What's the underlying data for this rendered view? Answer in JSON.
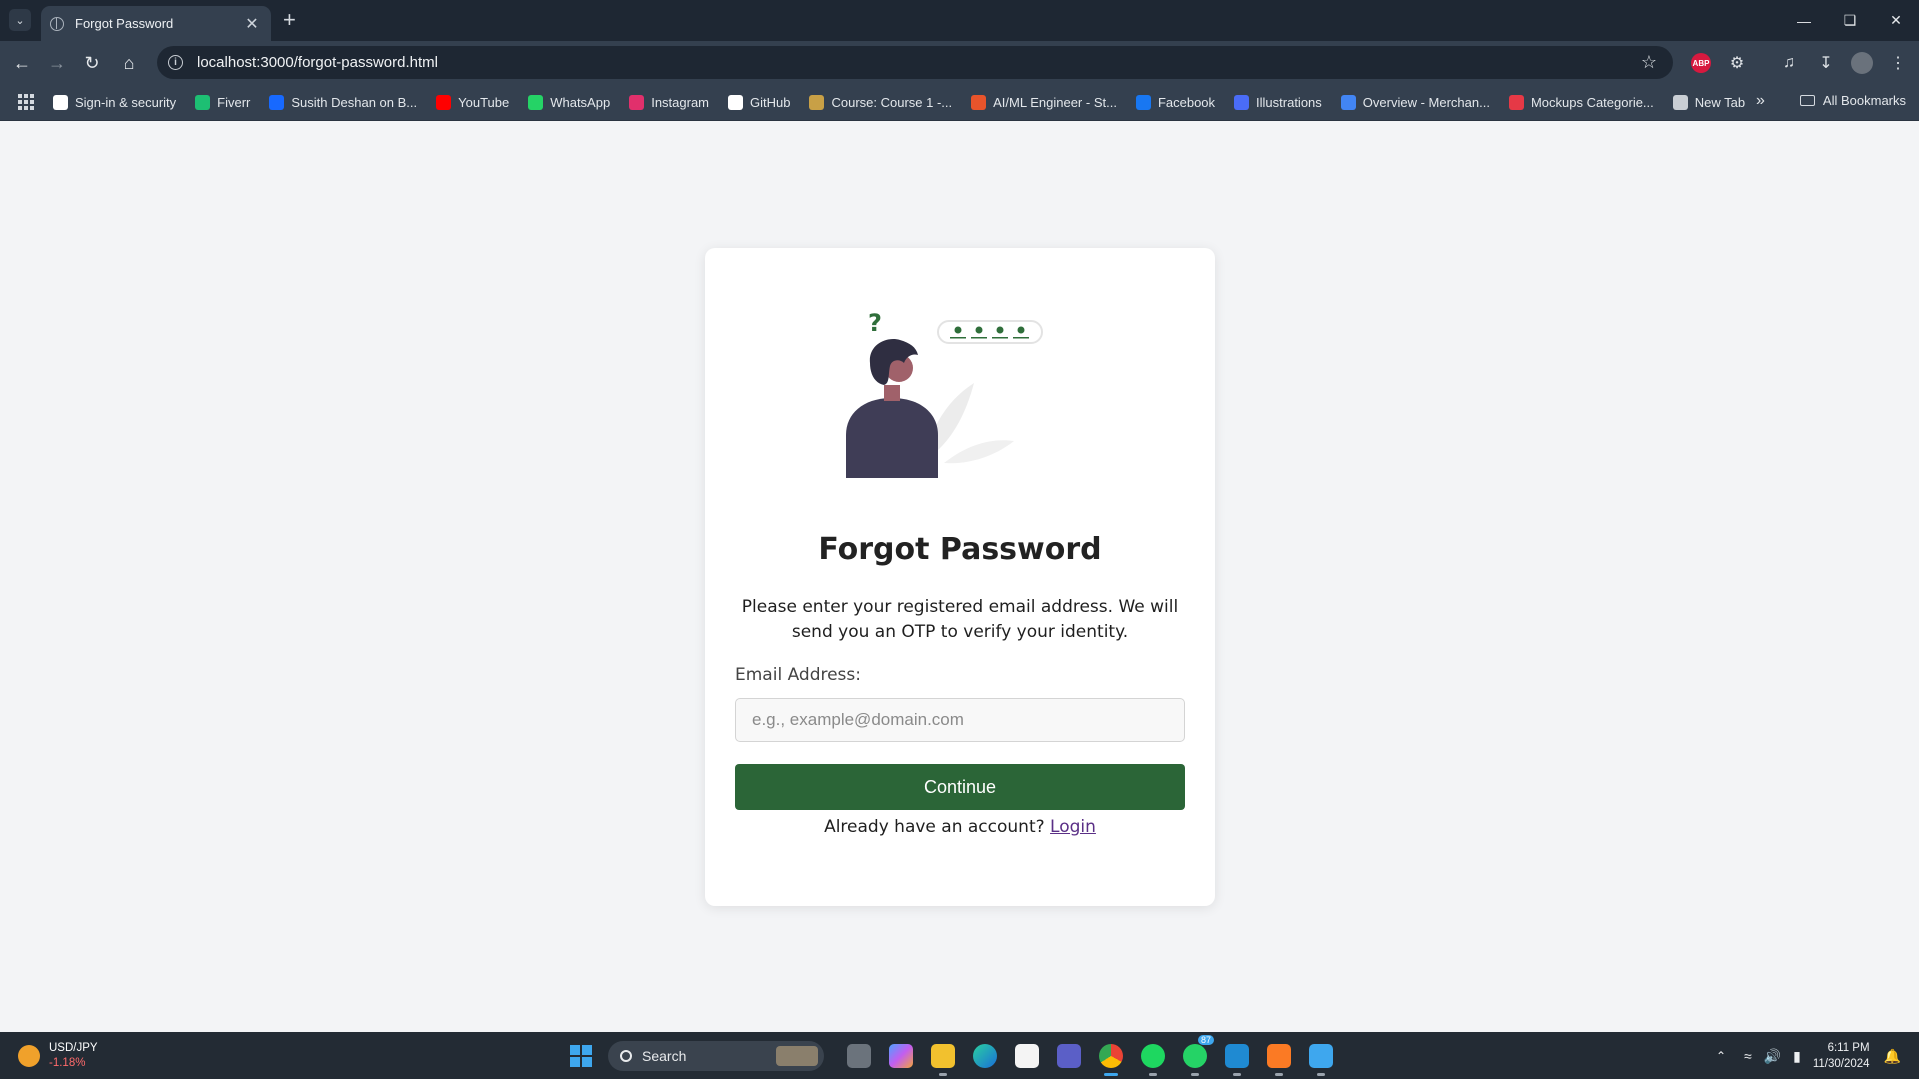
{
  "browser": {
    "tab_title": "Forgot Password",
    "url": "localhost:3000/forgot-password.html",
    "all_bookmarks_label": "All Bookmarks",
    "abp_label": "ABP",
    "bookmarks": [
      {
        "label": "Sign-in & security",
        "icon": "google-icon",
        "color": "#ffffff"
      },
      {
        "label": "Fiverr",
        "icon": "fiverr-icon",
        "color": "#1dbf73"
      },
      {
        "label": "Susith Deshan on B...",
        "icon": "behance-icon",
        "color": "#1769ff"
      },
      {
        "label": "YouTube",
        "icon": "youtube-icon",
        "color": "#ff0000"
      },
      {
        "label": "WhatsApp",
        "icon": "whatsapp-icon",
        "color": "#25d366"
      },
      {
        "label": "Instagram",
        "icon": "instagram-icon",
        "color": "#e1306c"
      },
      {
        "label": "GitHub",
        "icon": "github-icon",
        "color": "#ffffff"
      },
      {
        "label": "Course: Course 1 -...",
        "icon": "course-icon",
        "color": "#c8a046"
      },
      {
        "label": "AI/ML Engineer - St...",
        "icon": "aiml-icon",
        "color": "#e8542b"
      },
      {
        "label": "Facebook",
        "icon": "facebook-icon",
        "color": "#1877f2"
      },
      {
        "label": "Illustrations",
        "icon": "illustrations-icon",
        "color": "#4a6cf7"
      },
      {
        "label": "Overview - Merchan...",
        "icon": "merchant-icon",
        "color": "#4285f4"
      },
      {
        "label": "Mockups Categorie...",
        "icon": "mockups-icon",
        "color": "#e63946"
      },
      {
        "label": "New Tab",
        "icon": "globe-icon",
        "color": "#c9ced4"
      }
    ]
  },
  "page": {
    "title": "Forgot Password",
    "description": "Please enter your registered email address. We will send you an OTP to verify your identity.",
    "email_label": "Email Address:",
    "email_placeholder": "e.g., example@domain.com",
    "email_value": "",
    "continue_label": "Continue",
    "login_prompt": "Already have an account?",
    "login_link": "Login",
    "accent_color": "#2b6537"
  },
  "taskbar": {
    "ticker_symbol": "USD/JPY",
    "ticker_change": "-1.18%",
    "search_label": "Search",
    "whatsapp_badge": "87",
    "time": "6:11 PM",
    "date": "11/30/2024"
  }
}
